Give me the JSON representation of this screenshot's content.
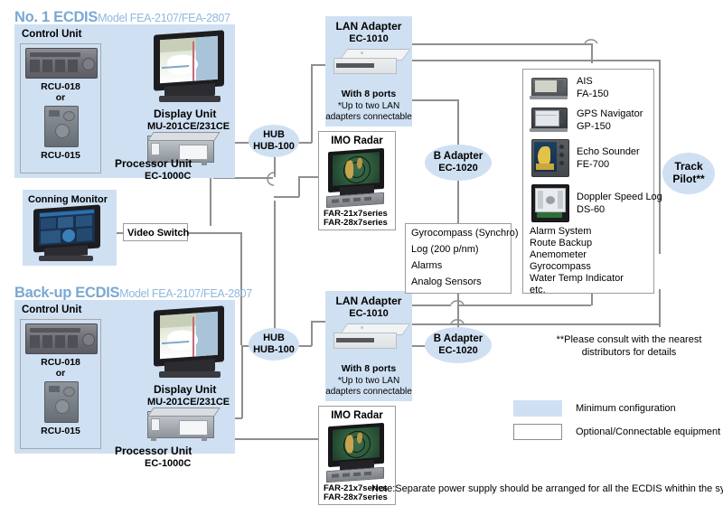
{
  "diagram": {
    "sections": [
      {
        "id": "no1-ecdis",
        "title_bold": "No. 1 ECDIS",
        "title_model": "Model FEA-2107/FEA-2807",
        "control_unit_label": "Control Unit",
        "rcu_top": "RCU-018",
        "rcu_or": "or",
        "rcu_bottom": "RCU-015",
        "display_unit_label": "Display Unit",
        "display_unit_model": "MU-201CE/231CE",
        "processor_label": "Processor Unit",
        "processor_model": "EC-1000C"
      },
      {
        "id": "backup-ecdis",
        "title_bold": "Back-up ECDIS",
        "title_model": "Model FEA-2107/FEA-2807",
        "control_unit_label": "Control Unit",
        "rcu_top": "RCU-018",
        "rcu_or": "or",
        "rcu_bottom": "RCU-015",
        "display_unit_label": "Display Unit",
        "display_unit_model": "MU-201CE/231CE",
        "processor_label": "Processor Unit",
        "processor_model": "EC-1000C"
      }
    ],
    "conning_monitor": {
      "label": "Conning Monitor"
    },
    "video_switch": {
      "label": "Video Switch"
    },
    "hubs": [
      {
        "id": "hub-top",
        "line1": "HUB",
        "line2": "HUB-100"
      },
      {
        "id": "hub-bottom",
        "line1": "HUB",
        "line2": "HUB-100"
      }
    ],
    "lan_adapters": [
      {
        "id": "lan-top",
        "title": "LAN Adapter",
        "model": "EC-1010",
        "ports": "With 8 ports",
        "note_line1": "*Up to two LAN",
        "note_line2": "adapters connectable"
      },
      {
        "id": "lan-bottom",
        "title": "LAN Adapter",
        "model": "EC-1010",
        "ports": "With 8 ports",
        "note_line1": "*Up to two LAN",
        "note_line2": "adapters connectable"
      }
    ],
    "radars": [
      {
        "id": "radar-top",
        "title": "IMO Radar",
        "model_line1": "FAR-21x7series",
        "model_line2": "FAR-28x7series"
      },
      {
        "id": "radar-bottom",
        "title": "IMO Radar",
        "model_line1": "FAR-21x7series",
        "model_line2": "FAR-28x7series"
      }
    ],
    "b_adapters": [
      {
        "id": "badapter-top",
        "line1": "B Adapter",
        "line2": "EC-1020"
      },
      {
        "id": "badapter-bottom",
        "line1": "B Adapter",
        "line2": "EC-1020"
      }
    ],
    "gyro_box": {
      "items": [
        "Gyrocompass (Synchro)",
        "Log (200 p/nm)",
        "Alarms",
        "Analog Sensors"
      ]
    },
    "sensor_box": {
      "devices": [
        {
          "name": "AIS",
          "model": "FA-150",
          "icon": "ais-device-icon"
        },
        {
          "name": "GPS Navigator",
          "model": "GP-150",
          "icon": "gps-device-icon"
        },
        {
          "name": "Echo Sounder",
          "model": "FE-700",
          "icon": "echo-sounder-device-icon"
        },
        {
          "name": "Doppler Speed Log",
          "model": "DS-60",
          "icon": "doppler-log-device-icon"
        }
      ],
      "extra_items": [
        "Alarm System",
        "Route Backup",
        "Anemometer",
        "Gyrocompass",
        "Water Temp Indicator",
        "etc."
      ]
    },
    "track_pilot": {
      "line1": "Track",
      "line2": "Pilot**"
    },
    "footnote": {
      "line1": "**Please consult with the nearest",
      "line2": "distributors for details"
    },
    "legend": {
      "items": [
        {
          "swatch": "blue-filled",
          "label": "Minimum configuration"
        },
        {
          "swatch": "white-outlined",
          "label": "Optional/Connectable equipment"
        }
      ]
    },
    "bottom_note": "Note:Separate power supply should be arranged for all the ECDIS whithin the system.",
    "colors": {
      "panel_blue": "#cfe0f2",
      "title_blue": "#7aa8d4",
      "line_gray": "#8f8f8f",
      "box_border": "#9b9b9b",
      "text": "#000000"
    }
  }
}
